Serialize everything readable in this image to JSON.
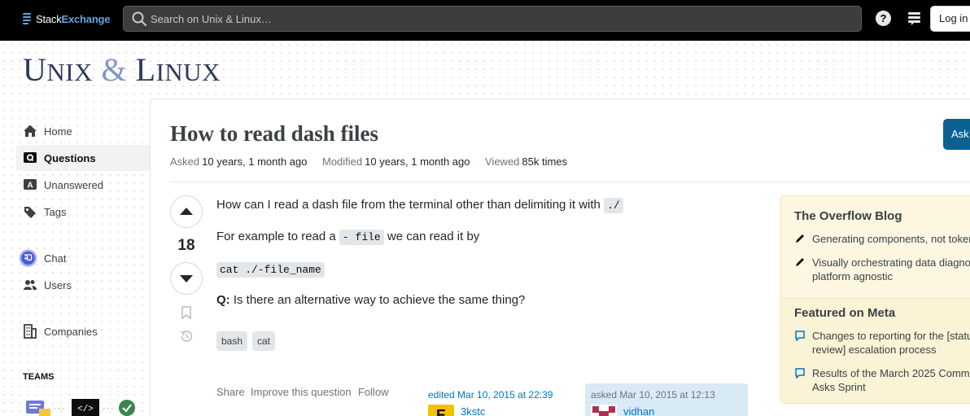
{
  "topbar": {
    "logo_text_a": "Stack",
    "logo_text_b": "Exchange",
    "search_placeholder": "Search on Unix & Linux…",
    "help_icon": "?",
    "login_label": "Log in"
  },
  "site": {
    "title_u": "U",
    "title_nix": "NIX",
    "title_amp": " & ",
    "title_l": "L",
    "title_inux": "INUX"
  },
  "nav": {
    "items": [
      {
        "label": "Home",
        "icon": "home-icon"
      },
      {
        "label": "Questions",
        "icon": "questions-icon",
        "active": true
      },
      {
        "label": "Unanswered",
        "icon": "unanswered-icon"
      },
      {
        "label": "Tags",
        "icon": "tag-icon"
      },
      {
        "label": "Chat",
        "icon": "chat-icon"
      },
      {
        "label": "Users",
        "icon": "users-icon"
      },
      {
        "label": "Companies",
        "icon": "companies-icon"
      }
    ],
    "teams_label": "TEAMS"
  },
  "question": {
    "title": "How to read dash files",
    "ask_label": "Ask",
    "asked_key": "Asked",
    "asked_val": "10 years, 1 month ago",
    "modified_key": "Modified",
    "modified_val": "10 years, 1 month ago",
    "viewed_key": "Viewed",
    "viewed_val": "85k times",
    "votes": "18",
    "p1": "How can I read a dash file from the terminal other than delimiting it with ",
    "p1_code": "./",
    "p2a": "For example to read a ",
    "p2_code": "- file",
    "p2b": " we can read it by",
    "p3_code": "cat ./-file_name",
    "p4_bold": "Q:",
    "p4": " Is there an alternative way to achieve the same thing?",
    "tags": [
      "bash",
      "cat"
    ],
    "menu": [
      "Share",
      "Improve this question",
      "Follow"
    ],
    "edited_text": "edited Mar 10, 2015 at 22:39",
    "edited_user": "3kstc",
    "edited_avatar_letter": "E",
    "asked_card_text": "asked Mar 10, 2015 at 12:13",
    "asked_user": "vidhan"
  },
  "sidebar_widget": {
    "blog_title": "The Overflow Blog",
    "blog_items": [
      "Generating components, not toker",
      "Visually orchestrating data diagno\nplatform agnostic"
    ],
    "meta_title": "Featured on Meta",
    "meta_items": [
      "Changes to reporting for the [statu\nreview] escalation process",
      "Results of the March 2025 Comm\nAsks Sprint"
    ]
  },
  "colors": {
    "topbar_bg": "#000000",
    "accent_blue": "#0a6293",
    "widget_bg": "#fdf7e2",
    "link": "#0074cc"
  }
}
